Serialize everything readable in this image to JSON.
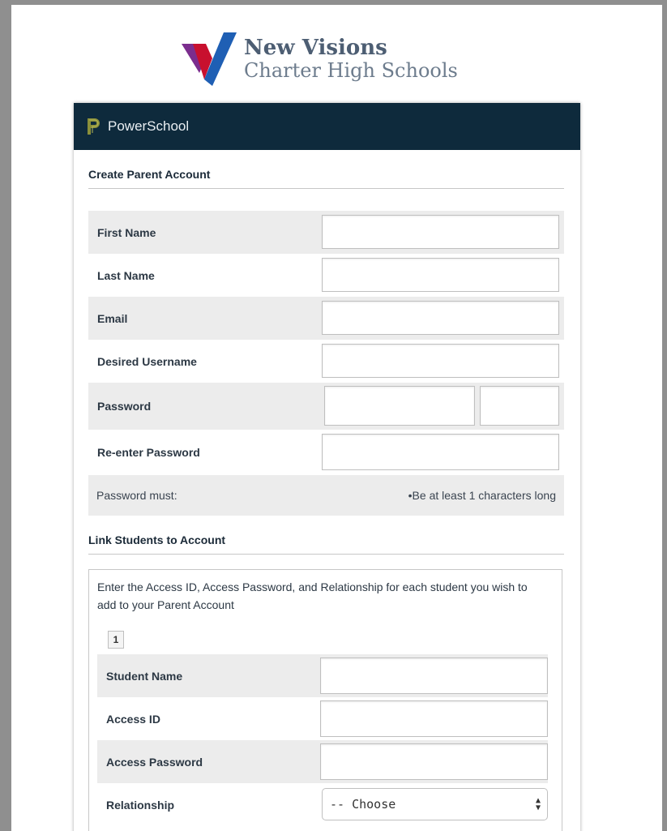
{
  "logo": {
    "line1": "New Visions",
    "line2": "Charter High Schools",
    "colors": [
      "#7b2d8e",
      "#c8102e",
      "#1f5fb4"
    ]
  },
  "header": {
    "app_name": "PowerSchool",
    "bg_color": "#0e2a3c",
    "logo_icon": "powerschool-p-icon"
  },
  "create_section": {
    "title": "Create Parent Account",
    "fields": {
      "first_name": {
        "label": "First Name",
        "value": ""
      },
      "last_name": {
        "label": "Last Name",
        "value": ""
      },
      "email": {
        "label": "Email",
        "value": ""
      },
      "username": {
        "label": "Desired Username",
        "value": ""
      },
      "password": {
        "label": "Password",
        "value": ""
      },
      "reenter_password": {
        "label": "Re-enter Password",
        "value": ""
      }
    },
    "password_rules": {
      "label": "Password must:",
      "rule": "•Be at least 1 characters long"
    }
  },
  "link_section": {
    "title": "Link Students to Account",
    "instructions": "Enter the Access ID, Access Password, and Relationship for each student you wish to add to your Parent Account",
    "student_tab": "1",
    "fields": {
      "student_name": {
        "label": "Student Name",
        "value": ""
      },
      "access_id": {
        "label": "Access ID",
        "value": ""
      },
      "access_password": {
        "label": "Access Password",
        "value": ""
      },
      "relationship": {
        "label": "Relationship",
        "selected": "-- Choose"
      }
    }
  }
}
